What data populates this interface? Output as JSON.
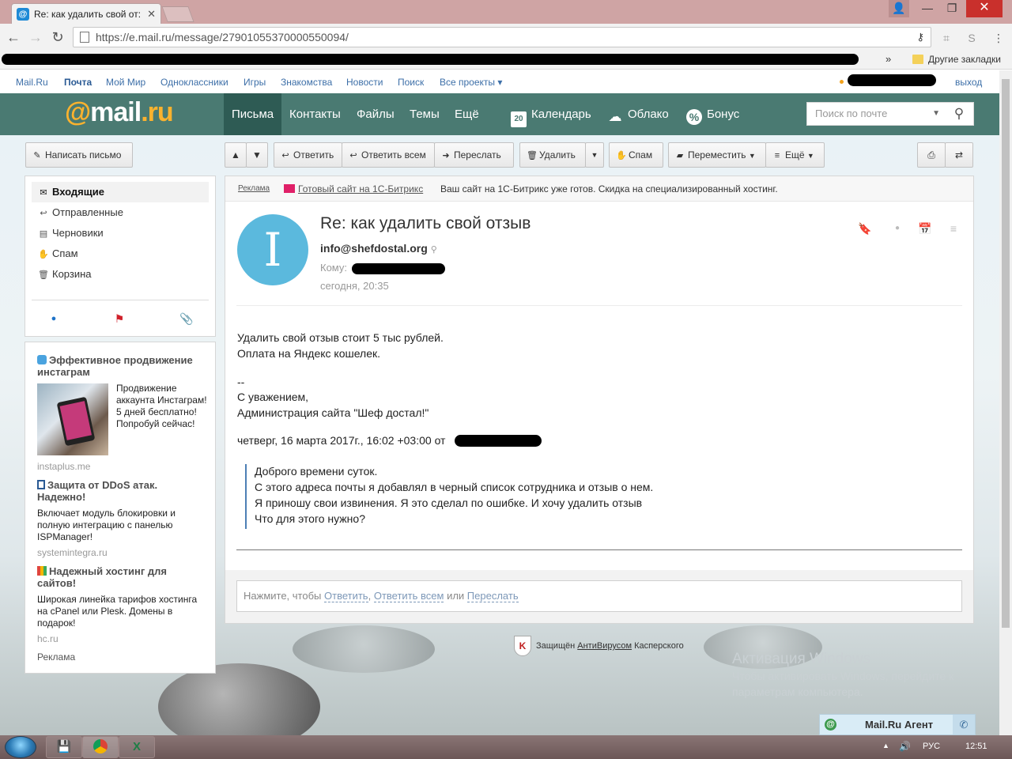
{
  "browser": {
    "tab_title": "Re: как удалить свой от:",
    "url": "https://e.mail.ru/message/27901055370000550094/",
    "other_bookmarks": "Другие закладки",
    "more": "»"
  },
  "portal": {
    "links": [
      "Mail.Ru",
      "Почта",
      "Мой Мир",
      "Одноклассники",
      "Игры",
      "Знакомства",
      "Новости",
      "Поиск",
      "Все проекты ▾"
    ],
    "logout": "выход"
  },
  "header": {
    "logo_at": "@",
    "logo_mail": "mail",
    "logo_ru": ".ru",
    "nav": [
      "Письма",
      "Контакты",
      "Файлы",
      "Темы",
      "Ещё"
    ],
    "calendar_day": "20",
    "calendar": "Календарь",
    "cloud": "Облако",
    "bonus": "Бонус",
    "search_placeholder": "Поиск по почте"
  },
  "toolbar": {
    "compose": "Написать письмо",
    "reply": "Ответить",
    "reply_all": "Ответить всем",
    "forward": "Переслать",
    "delete": "Удалить",
    "spam": "Спам",
    "move": "Переместить",
    "more": "Ещё"
  },
  "folders": [
    {
      "icon": "envelope-icon",
      "glyph": "✉",
      "label": "Входящие"
    },
    {
      "icon": "sent-icon",
      "glyph": "↩",
      "label": "Отправленные"
    },
    {
      "icon": "draft-icon",
      "glyph": "▤",
      "label": "Черновики"
    },
    {
      "icon": "spam-icon",
      "glyph": "✋",
      "label": "Спам"
    },
    {
      "icon": "trash-icon",
      "glyph": "🗑",
      "label": "Корзина"
    }
  ],
  "ads": [
    {
      "title": "Эффективное продвижение инстаграм",
      "text": "Продвижение аккаунта Инстаграм! 5 дней бесплатно! Попробуй сейчас!",
      "domain": "instaplus.me"
    },
    {
      "title": "Защита от DDoS атак. Надежно!",
      "text": "Включает модуль блокировки и полную интеграцию с панелью ISPManager!",
      "domain": "systemintegra.ru"
    },
    {
      "title": "Надежный хостинг для сайтов!",
      "text": "Широкая линейка тарифов хостинга на cPanel или Plesk. Домены в подарок!",
      "domain": "hc.ru"
    }
  ],
  "ads_label": "Реклама",
  "adbar": {
    "label": "Реклама",
    "link": "Готовый сайт на 1С-Битрикс",
    "text": "Ваш сайт на 1С-Битрикс уже готов. Скидка на специализированный хостинг."
  },
  "message": {
    "avatar_letter": "I",
    "subject": "Re: как удалить свой отзыв",
    "from": "info@shefdostal.org",
    "to_label": "Кому:",
    "date": "сегодня, 20:35",
    "body": [
      "Удалить свой отзыв стоит 5 тыс рублей.",
      "Оплата на Яндекс кошелек.",
      "--",
      "С уважением,",
      "Администрация сайта \"Шеф достал!\""
    ],
    "quote_header": "четверг, 16 марта 2017г., 16:02 +03:00 от",
    "quote": [
      "Доброго времени суток.",
      "С этого адреса почты я добавлял в черный список сотрудника и отзыв о нем.",
      "Я приношу свои извинения. Я это сделал по ошибке. И хочу удалить отзыв",
      "Что для этого нужно?"
    ]
  },
  "reply": {
    "prefix": "Нажмите, чтобы",
    "reply": "Ответить",
    "reply_all": "Ответить всем",
    "or": "или",
    "forward": "Переслать"
  },
  "kaspersky": {
    "prefix": "Защищён",
    "link": "АнтиВирусом",
    "suffix": "Касперского"
  },
  "activation": {
    "title": "Активация Windows",
    "line1": "Чтобы активировать Windows, перейдите к",
    "line2": "параметрам компьютера."
  },
  "agent": {
    "label": "Mail.Ru Агент"
  },
  "taskbar": {
    "lang": "РУС",
    "time": "12:51"
  }
}
